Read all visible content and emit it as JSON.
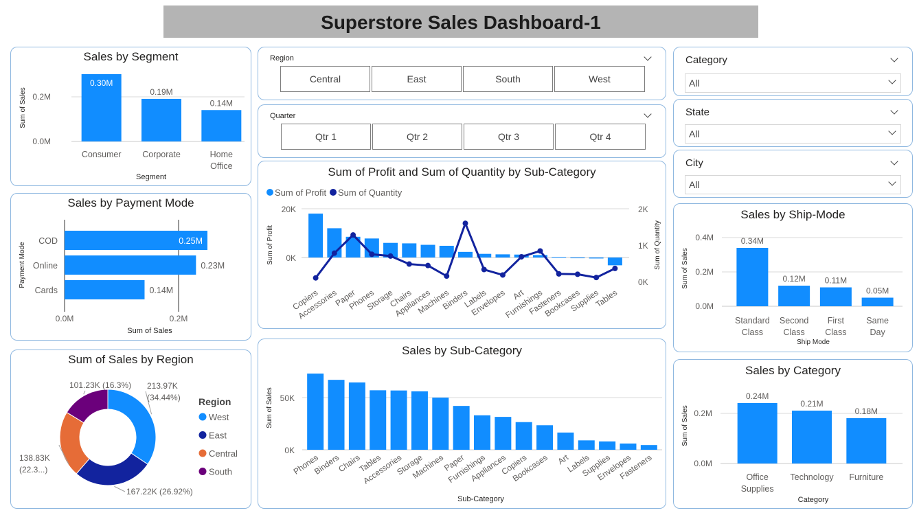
{
  "dashboard": {
    "title": "Superstore Sales Dashboard-1"
  },
  "filters": {
    "region": {
      "title": "Region",
      "options": [
        "Central",
        "East",
        "South",
        "West"
      ]
    },
    "quarter": {
      "title": "Quarter",
      "options": [
        "Qtr 1",
        "Qtr 2",
        "Qtr 3",
        "Qtr 4"
      ]
    },
    "category": {
      "title": "Category",
      "value": "All"
    },
    "state": {
      "title": "State",
      "value": "All"
    },
    "city": {
      "title": "City",
      "value": "All"
    }
  },
  "colors": {
    "blue": "#118DFF",
    "navy": "#12239E",
    "orange": "#E66C37",
    "purple": "#6B007B",
    "banner": "#b4b4b4",
    "border": "#8fb8e0"
  },
  "chart_data": [
    {
      "id": "segment",
      "type": "bar",
      "title": "Sales by Segment",
      "xlabel": "Segment",
      "ylabel": "Sum of Sales",
      "categories": [
        "Consumer",
        "Corporate",
        "Home Office"
      ],
      "category_lines": [
        [
          "Consumer"
        ],
        [
          "Corporate"
        ],
        [
          "Home",
          "Office"
        ]
      ],
      "values": [
        0.3,
        0.19,
        0.14
      ],
      "data_labels": [
        "0.30M",
        "0.19M",
        "0.14M"
      ],
      "yticks": [
        "0.0M",
        "0.2M"
      ],
      "ylim": [
        0,
        0.3
      ]
    },
    {
      "id": "payment",
      "type": "bar",
      "orientation": "horizontal",
      "title": "Sales by Payment Mode",
      "xlabel": "Sum of Sales",
      "ylabel": "Payment Mode",
      "categories": [
        "COD",
        "Online",
        "Cards"
      ],
      "values": [
        0.25,
        0.23,
        0.14
      ],
      "data_labels": [
        "0.25M",
        "0.23M",
        "0.14M"
      ],
      "xticks": [
        "0.0M",
        "0.2M"
      ],
      "xlim": [
        0,
        0.25
      ]
    },
    {
      "id": "region",
      "type": "pie",
      "title": "Sum of Sales by Region",
      "legend_title": "Region",
      "slices": [
        {
          "name": "West",
          "value": 213.97,
          "label": [
            "213.97K",
            "(34.44%)"
          ]
        },
        {
          "name": "East",
          "value": 167.22,
          "label": [
            "167.22K (26.92%)"
          ]
        },
        {
          "name": "Central",
          "value": 138.83,
          "label": [
            "138.83K",
            "(22.3...)"
          ]
        },
        {
          "name": "South",
          "value": 101.23,
          "label": [
            "101.23K (16.3%)"
          ]
        }
      ]
    },
    {
      "id": "profit_qty",
      "type": "bar",
      "title": "Sum of Profit and Sum of Quantity by Sub-Category",
      "ylabel": "Sum of Profit",
      "y2label": "Sum of Quantity",
      "legend": [
        "Sum of Profit",
        "Sum of Quantity"
      ],
      "categories": [
        "Copiers",
        "Accessories",
        "Paper",
        "Phones",
        "Storage",
        "Chairs",
        "Appliances",
        "Machines",
        "Binders",
        "Labels",
        "Envelopes",
        "Art",
        "Furnishings",
        "Fasteners",
        "Bookcases",
        "Supplies",
        "Tables"
      ],
      "series": [
        {
          "name": "Sum of Profit",
          "type": "bar",
          "values": [
            18000,
            12000,
            8500,
            7800,
            6000,
            5800,
            5200,
            4800,
            2300,
            1500,
            1300,
            1200,
            1000,
            200,
            -300,
            -400,
            -3200
          ]
        },
        {
          "name": "Sum of Quantity",
          "type": "line",
          "values": [
            100,
            780,
            1280,
            750,
            700,
            480,
            440,
            150,
            1600,
            330,
            180,
            680,
            840,
            210,
            200,
            110,
            360
          ]
        }
      ],
      "yticks": [
        "0K",
        "20K"
      ],
      "y2ticks": [
        "0K",
        "1K",
        "2K"
      ],
      "ylim": [
        -5000,
        25000
      ],
      "y2lim": [
        0,
        2000
      ]
    },
    {
      "id": "subcat",
      "type": "bar",
      "title": "Sales by Sub-Category",
      "xlabel": "Sub-Category",
      "ylabel": "Sum of Sales",
      "categories": [
        "Phones",
        "Binders",
        "Chairs",
        "Tables",
        "Accessories",
        "Storage",
        "Machines",
        "Paper",
        "Furnishings",
        "Appliances",
        "Copiers",
        "Bookcases",
        "Art",
        "Labels",
        "Supplies",
        "Envelopes",
        "Fasteners"
      ],
      "values": [
        73000,
        67000,
        64500,
        57000,
        56800,
        56000,
        50000,
        42000,
        33000,
        31500,
        26500,
        23500,
        16500,
        9000,
        8000,
        6000,
        4500
      ],
      "yticks": [
        "0K",
        "50K"
      ],
      "ylim": [
        0,
        75000
      ]
    },
    {
      "id": "shipmode",
      "type": "bar",
      "title": "Sales by Ship-Mode",
      "xlabel": "Ship Mode",
      "ylabel": "Sum of Sales",
      "categories": [
        "Standard Class",
        "Second Class",
        "First Class",
        "Same Day"
      ],
      "category_lines": [
        [
          "Standard",
          "Class"
        ],
        [
          "Second",
          "Class"
        ],
        [
          "First",
          "Class"
        ],
        [
          "Same",
          "Day"
        ]
      ],
      "values": [
        0.34,
        0.12,
        0.11,
        0.05
      ],
      "data_labels": [
        "0.34M",
        "0.12M",
        "0.11M",
        "0.05M"
      ],
      "yticks": [
        "0.0M",
        "0.2M",
        "0.4M"
      ],
      "ylim": [
        0,
        0.4
      ]
    },
    {
      "id": "category",
      "type": "bar",
      "title": "Sales by Category",
      "xlabel": "Category",
      "ylabel": "Sum of Sales",
      "categories": [
        "Office Supplies",
        "Technology",
        "Furniture"
      ],
      "category_lines": [
        [
          "Office",
          "Supplies"
        ],
        [
          "Technology"
        ],
        [
          "Furniture"
        ]
      ],
      "values": [
        0.24,
        0.21,
        0.18
      ],
      "data_labels": [
        "0.24M",
        "0.21M",
        "0.18M"
      ],
      "yticks": [
        "0.0M",
        "0.2M"
      ],
      "ylim": [
        0,
        0.24
      ]
    }
  ]
}
